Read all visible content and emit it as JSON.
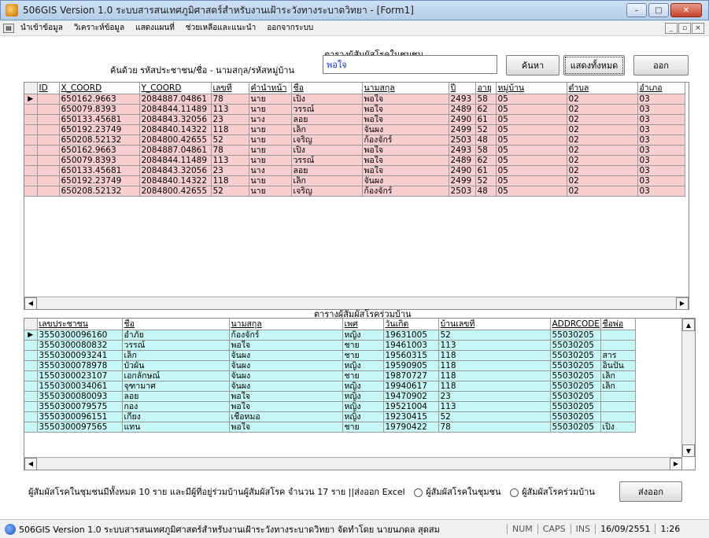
{
  "window": {
    "title": "506GIS Version 1.0  ระบบสารสนเทศภูมิศาสตร์สำหรับงานเฝ้าระวังทางระบาดวิทยา - [Form1]",
    "minimize": "–",
    "maximize": "□",
    "close": "✕"
  },
  "menu": [
    "นำเข้าข้อมูล",
    "วิเคราะห์ข้อมูล",
    "แสดงแผนที่",
    "ช่วยเหลือและแนะนำ",
    "ออกจากระบบ"
  ],
  "mdi": {
    "minimize": "_",
    "restore": "▫",
    "close": "×"
  },
  "top_heading": "ตารางผู้สัมผัสโรคในชุมชน",
  "search": {
    "label": "ค้นด้วย รหัสประชาชน/ชื่อ - นามสกุล/รหัสหมู่บ้าน",
    "value": "พอใจ",
    "search_button": "ค้นหา",
    "show_all_button": "แสดงทั้งหมด",
    "exit_button": "ออก"
  },
  "community_table": {
    "columns": [
      "ID",
      "X_COORD",
      "Y_COORD",
      "เลขที่",
      "คำนำหน้า",
      "ชื่อ",
      "นามสกุล",
      "ปี",
      "อายุ",
      "หมู่บ้าน",
      "ตำบล",
      "อำเภอ"
    ],
    "rows": [
      [
        "",
        "650162.9663",
        "2084887.04861",
        "78",
        "นาย",
        "เปิง",
        "พอใจ",
        "2493",
        "58",
        "05",
        "02",
        "03"
      ],
      [
        "",
        "650079.8393",
        "2084844.11489",
        "113",
        "นาย",
        "วรรณ์",
        "พอใจ",
        "2489",
        "62",
        "05",
        "02",
        "03"
      ],
      [
        "",
        "650133.45681",
        "2084843.32056",
        "23",
        "นาง",
        "ลอย",
        "พอใจ",
        "2490",
        "61",
        "05",
        "02",
        "03"
      ],
      [
        "",
        "650192.23749",
        "2084840.14322",
        "118",
        "นาย",
        "เล็ก",
        "จันผง",
        "2499",
        "52",
        "05",
        "02",
        "03"
      ],
      [
        "",
        "650208.52132",
        "2084800.42655",
        "52",
        "นาย",
        "เจริญ",
        "ก้องจักร์",
        "2503",
        "48",
        "05",
        "02",
        "03"
      ],
      [
        "",
        "650162.9663",
        "2084887.04861",
        "78",
        "นาย",
        "เปิง",
        "พอใจ",
        "2493",
        "58",
        "05",
        "02",
        "03"
      ],
      [
        "",
        "650079.8393",
        "2084844.11489",
        "113",
        "นาย",
        "วรรณ์",
        "พอใจ",
        "2489",
        "62",
        "05",
        "02",
        "03"
      ],
      [
        "",
        "650133.45681",
        "2084843.32056",
        "23",
        "นาง",
        "ลอย",
        "พอใจ",
        "2490",
        "61",
        "05",
        "02",
        "03"
      ],
      [
        "",
        "650192.23749",
        "2084840.14322",
        "118",
        "นาย",
        "เล็ก",
        "จันผง",
        "2499",
        "52",
        "05",
        "02",
        "03"
      ],
      [
        "",
        "650208.52132",
        "2084800.42655",
        "52",
        "นาย",
        "เจริญ",
        "ก้องจักร์",
        "2503",
        "48",
        "05",
        "02",
        "03"
      ]
    ]
  },
  "household_heading": "ตารางผู้สัมผัสโรคร่วมบ้าน",
  "household_table": {
    "columns": [
      "เลขประชาชน",
      "ชื่อ",
      "นามสกุล",
      "เพศ",
      "วันเกิด",
      "บ้านเลขที่",
      "ADDRCODE",
      "ชื่อพ่อ"
    ],
    "rows": [
      [
        "3550300096160",
        "อำภัย",
        "ก้องจักร์",
        "หญิง",
        "19631005",
        "52",
        "55030205",
        ""
      ],
      [
        "3550300080832",
        "วรรณ์",
        "พอใจ",
        "ชาย",
        "19461003",
        "113",
        "55030205",
        ""
      ],
      [
        "3550300093241",
        "เล็ก",
        "จันผง",
        "ชาย",
        "19560315",
        "118",
        "55030205",
        "สาร"
      ],
      [
        "3550300078978",
        "บัวผัน",
        "จันผง",
        "หญิง",
        "19590905",
        "118",
        "55030205",
        "อินปั๋น"
      ],
      [
        "1550300023107",
        "เอกลักษณ์",
        "จันผง",
        "ชาย",
        "19870727",
        "118",
        "55030205",
        "เล็ก"
      ],
      [
        "1550300034061",
        "จุฑามาศ",
        "จันผง",
        "หญิง",
        "19940617",
        "118",
        "55030205",
        "เล็ก"
      ],
      [
        "3550300080093",
        "ลอย",
        "พอใจ",
        "หญิง",
        "19470902",
        "23",
        "55030205",
        ""
      ],
      [
        "3550300079575",
        "กอง",
        "พอใจ",
        "หญิง",
        "19521004",
        "113",
        "55030205",
        ""
      ],
      [
        "3550300096151",
        "เกี๋ยง",
        "เชื้อหมอ",
        "หญิง",
        "19230415",
        "52",
        "55030205",
        ""
      ],
      [
        "3550300097565",
        "แทน",
        "พอใจ",
        "ชาย",
        "19790422",
        "78",
        "55030205",
        "เปิง"
      ]
    ]
  },
  "summary": {
    "text": "ผู้สัมผัสโรคในชุมชนมีทั้งหมด  10  ราย  และมีผู้ที่อยู่ร่วมบ้านผู้สัมผัสโรค จำนวน  17  ราย  ||ส่งออก Excel",
    "radio_community": "ผู้สัมผัสโรคในชุมชน",
    "radio_household": "ผู้สัมผัสโรคร่วมบ้าน",
    "export_button": "ส่งออก"
  },
  "status": {
    "text": "506GIS Version 1.0  ระบบสารสนเทศภูมิศาสตร์สำหรับงานเฝ้าระวังทางระบาดวิทยา จัดทำโดย นายนภดล สุดสม",
    "num": "NUM",
    "caps": "CAPS",
    "ins": "INS",
    "date": "16/09/2551",
    "time": "1:26"
  },
  "scroll": {
    "left": "◀",
    "right": "▶",
    "up": "▲",
    "down": "▼",
    "row_pointer": "▶"
  }
}
